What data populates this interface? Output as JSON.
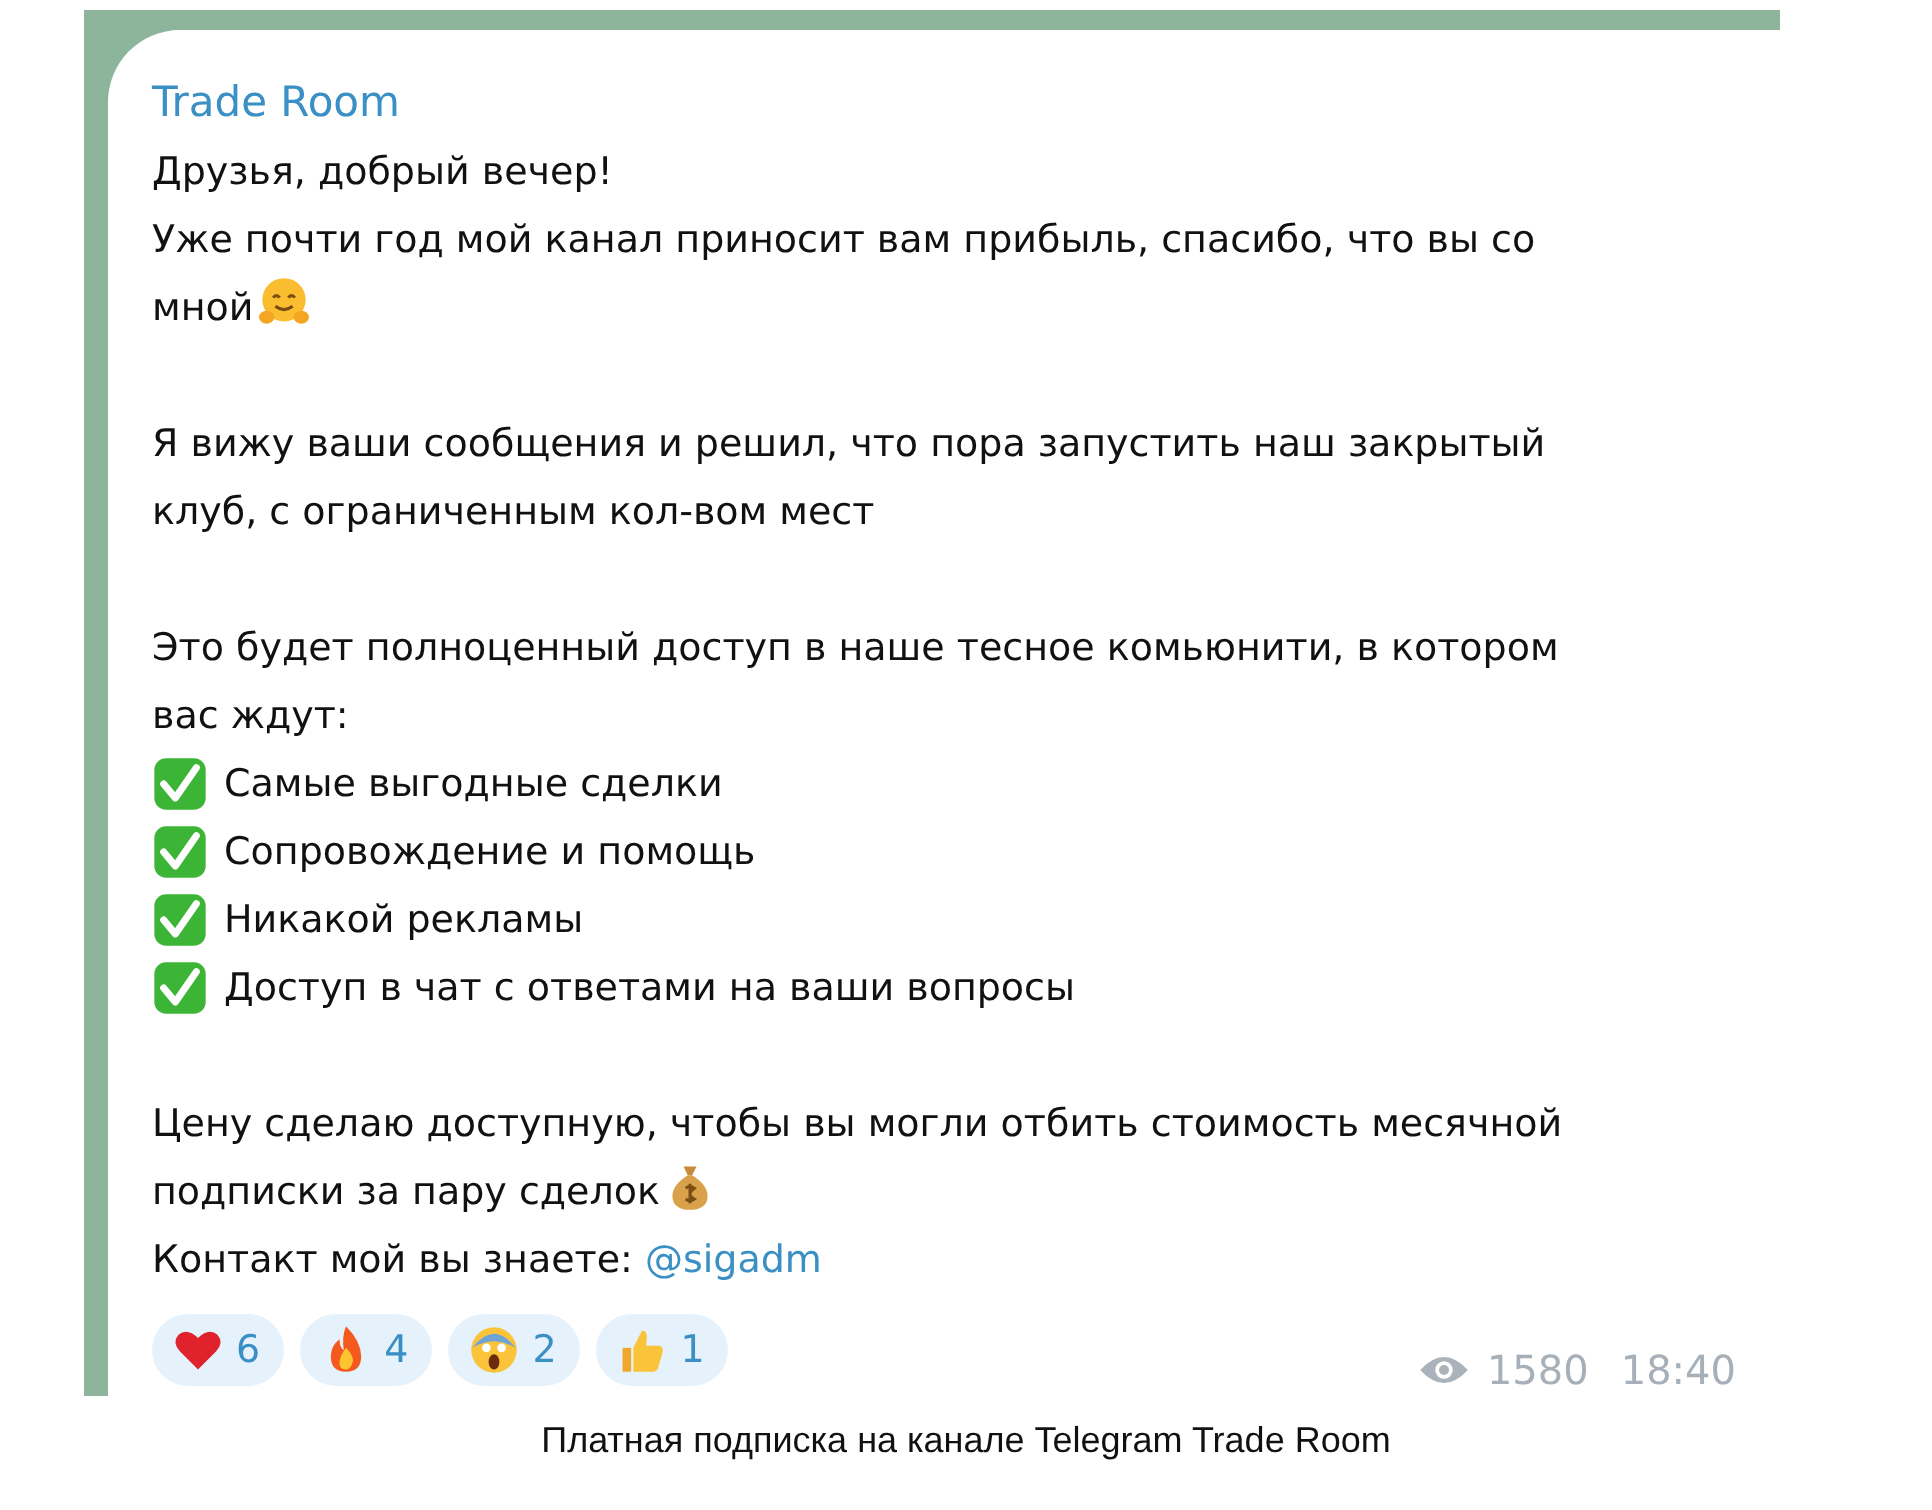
{
  "message": {
    "sender": "Trade Room",
    "lines": [
      {
        "kind": "text",
        "text": "Друзья, добрый вечер!"
      },
      {
        "kind": "text",
        "text": "Уже почти год мой канал приносит вам прибыль, спасибо, что вы со мной"
      },
      {
        "kind": "gap"
      },
      {
        "kind": "text",
        "text": "Я вижу ваши сообщения и решил, что пора запустить наш закрытый клуб, с ограниченным кол-вом мест"
      },
      {
        "kind": "gap"
      },
      {
        "kind": "text",
        "text": "Это будет полноценный доступ в наше тесное комьюнити, в котором вас ждут:"
      },
      {
        "kind": "check",
        "text": "Самые выгодные сделки"
      },
      {
        "kind": "check",
        "text": "Сопровождение и помощь"
      },
      {
        "kind": "check",
        "text": "Никакой рекламы"
      },
      {
        "kind": "check",
        "text": "Доступ в чат с ответами на ваши вопросы"
      },
      {
        "kind": "gap"
      },
      {
        "kind": "text",
        "text": "Цену сделаю доступную, чтобы вы могли отбить стоимость месячной подписки за пару сделок"
      },
      {
        "kind": "text",
        "text": "Контакт мой вы знаете: ",
        "link": "@sigadm"
      }
    ],
    "reactions": [
      {
        "kind": "heart",
        "count": "6"
      },
      {
        "kind": "fire",
        "count": "4"
      },
      {
        "kind": "scream",
        "count": "2"
      },
      {
        "kind": "thumbs",
        "count": "1"
      }
    ],
    "views": "1580",
    "time": "18:40"
  },
  "caption": "Платная подписка на канале Telegram Trade Room"
}
